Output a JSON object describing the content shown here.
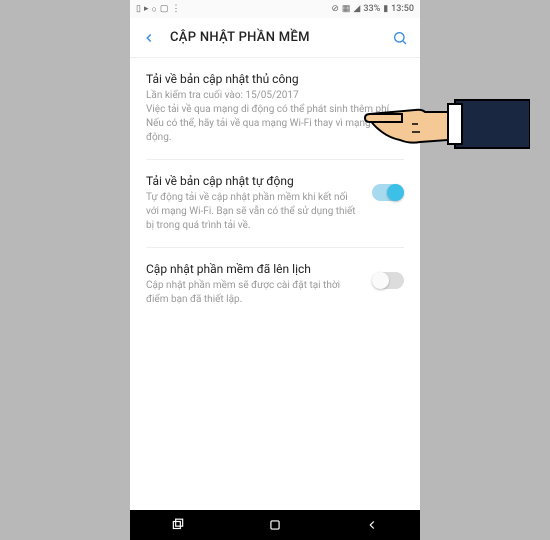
{
  "status": {
    "battery": "33%",
    "time": "13:50"
  },
  "header": {
    "title": "CẬP NHẬT PHẦN MỀM"
  },
  "settings": {
    "manual": {
      "title": "Tải về bản cập nhật thủ công",
      "desc": "Lần kiểm tra cuối vào: 15/05/2017\nViệc tải về qua mạng di động có thể phát sinh thêm phí. Nếu có thể, hãy tải về qua mạng Wi-Fi thay vì mạng di động."
    },
    "auto": {
      "title": "Tải về bản cập nhật tự động",
      "desc": "Tự động tải về cập nhật phần mềm khi kết nối với mạng Wi-Fi. Bạn sẽ vẫn có thể sử dụng thiết bị trong quá trình tải về."
    },
    "scheduled": {
      "title": "Cập nhật phần mềm đã lên lịch",
      "desc": "Cập nhật phần mềm sẽ được cài đặt tại thời điểm bạn đã thiết lập."
    }
  }
}
